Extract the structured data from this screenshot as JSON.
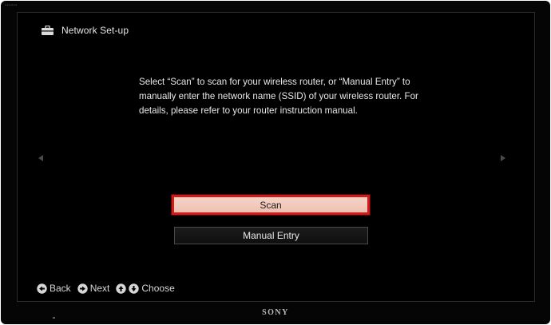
{
  "header": {
    "title": "Network Set-up",
    "icon": "toolbox-icon"
  },
  "instruction": "Select “Scan” to scan for your wireless router, or “Manual Entry” to manually enter the network name (SSID) of your wireless router. For details, please refer to your router instruction manual.",
  "buttons": {
    "scan": "Scan",
    "manual_entry": "Manual Entry"
  },
  "navigation": {
    "back": "Back",
    "next": "Next",
    "choose": "Choose"
  },
  "tv": {
    "brand": "SONY"
  },
  "colors": {
    "selected_bg": "#f2c8b8",
    "selected_border": "#d11a1a",
    "screen_bg": "#000000",
    "text": "#e6e6e6"
  }
}
